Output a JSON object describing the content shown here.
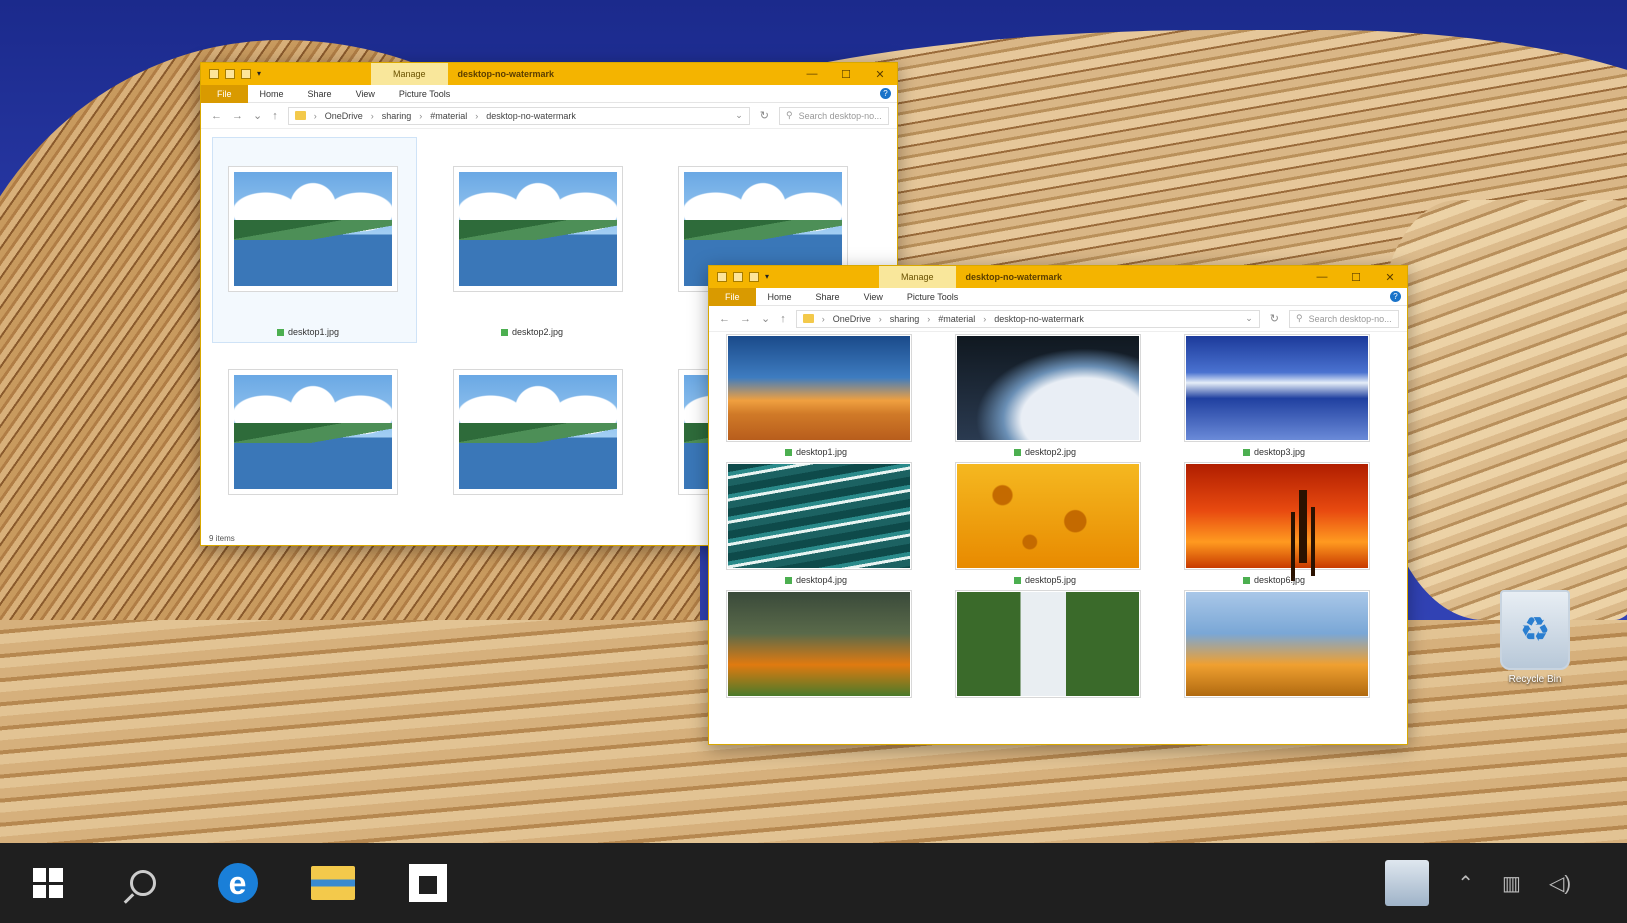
{
  "window_back": {
    "quick_access": "▾",
    "manage_tab": "Manage",
    "title": "desktop-no-watermark",
    "controls": {
      "minimize": "—",
      "maximize": "☐",
      "close": "✕"
    },
    "ribbon_tabs": [
      "File",
      "Home",
      "Share",
      "View",
      "Picture Tools"
    ],
    "help": "?",
    "breadcrumbs": [
      "OneDrive",
      "sharing",
      "#material",
      "desktop-no-watermark"
    ],
    "search_placeholder": "Search desktop-no...",
    "status": "9 items",
    "files": [
      {
        "name": "desktop1.jpg",
        "thumb": "placeholder"
      },
      {
        "name": "desktop2.jpg",
        "thumb": "placeholder"
      },
      {
        "name": "",
        "thumb": "placeholder"
      },
      {
        "name": "",
        "thumb": "placeholder"
      },
      {
        "name": "",
        "thumb": "placeholder"
      },
      {
        "name": "",
        "thumb": "placeholder"
      }
    ]
  },
  "window_front": {
    "quick_access": "▾",
    "manage_tab": "Manage",
    "title": "desktop-no-watermark",
    "controls": {
      "minimize": "—",
      "maximize": "☐",
      "close": "✕"
    },
    "ribbon_tabs": [
      "File",
      "Home",
      "Share",
      "View",
      "Picture Tools"
    ],
    "help": "?",
    "breadcrumbs": [
      "OneDrive",
      "sharing",
      "#material",
      "desktop-no-watermark"
    ],
    "search_placeholder": "Search desktop-no...",
    "files": [
      {
        "name": "desktop1.jpg",
        "thumb": "desert"
      },
      {
        "name": "desktop2.jpg",
        "thumb": "planet"
      },
      {
        "name": "desktop3.jpg",
        "thumb": "mountain"
      },
      {
        "name": "desktop4.jpg",
        "thumb": "waves"
      },
      {
        "name": "desktop5.jpg",
        "thumb": "dots"
      },
      {
        "name": "desktop6.jpg",
        "thumb": "sunset"
      },
      {
        "name": "",
        "thumb": "forest"
      },
      {
        "name": "",
        "thumb": "waterfall"
      },
      {
        "name": "",
        "thumb": "field"
      }
    ]
  },
  "desktop": {
    "recycle_bin_label": "Recycle Bin"
  },
  "taskbar": {
    "items": [
      "start-icon",
      "search-icon",
      "edge-icon",
      "file-explorer-icon",
      "store-icon"
    ],
    "tray": {
      "clock_time": "",
      "clock_date": ""
    }
  },
  "colors": {
    "titlebar": "#f4b400",
    "file_tab": "#d99a00",
    "taskbar": "#1f1f1f",
    "sky": "#2a3aa8"
  }
}
